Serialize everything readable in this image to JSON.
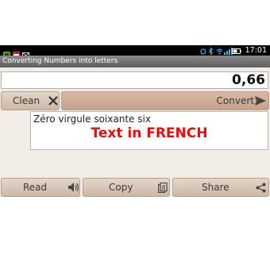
{
  "status_bar": {
    "time": "17:01",
    "left_icons": [
      "app-notification-icon",
      "calendar-icon",
      "email-icon"
    ],
    "right_icons": [
      "alarm-icon",
      "bluetooth-icon",
      "wifi-icon",
      "signal-icon",
      "battery-icon"
    ]
  },
  "app": {
    "title": "Converting Numbers into letters",
    "number_value": "0,66",
    "clean_label": "Clean",
    "convert_label": "Convert",
    "result_text": "Zéro virgule soixante six",
    "result_note": "Text in FRENCH",
    "read_label": "Read",
    "copy_label": "Copy",
    "share_label": "Share"
  },
  "colors": {
    "note": "#e01010",
    "button": "#d7c3b1",
    "convert_button": "#cfae98",
    "background": "#f1ede6"
  }
}
